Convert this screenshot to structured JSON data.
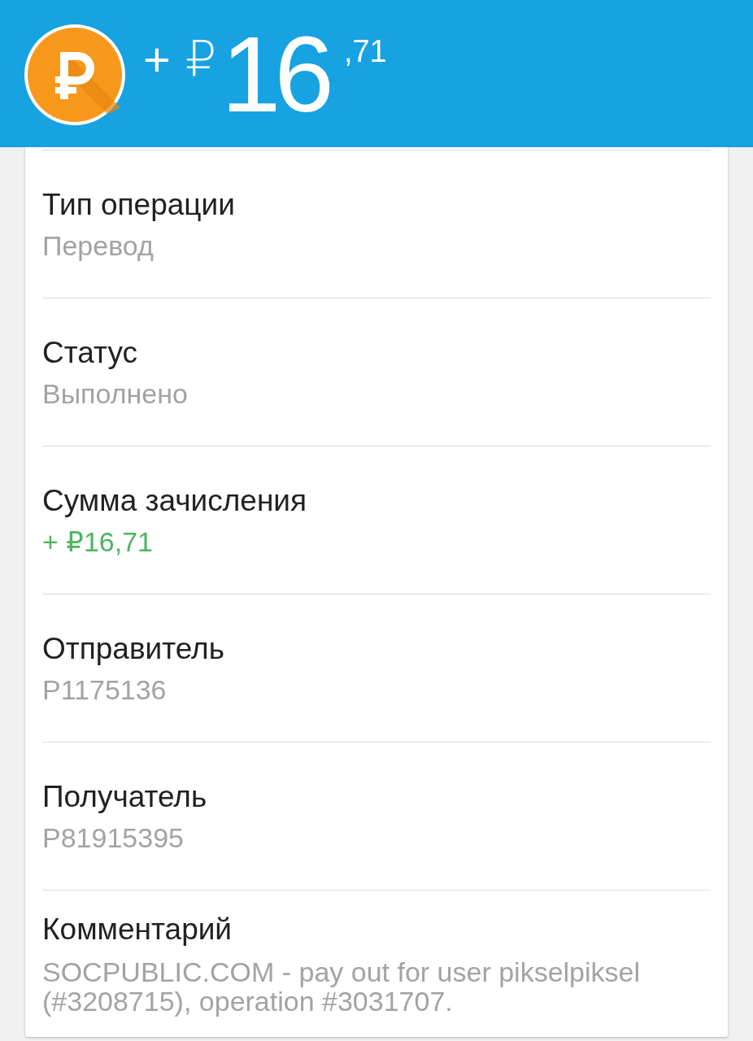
{
  "header": {
    "amount": {
      "sign": "+",
      "currency": "₽",
      "whole": "16",
      "fraction": ",71"
    }
  },
  "details": [
    {
      "label": "Тип операции",
      "value": "Перевод",
      "kind": "text"
    },
    {
      "label": "Статус",
      "value": "Выполнено",
      "kind": "text"
    },
    {
      "label": "Сумма зачисления",
      "value": "+ ₽16,71",
      "kind": "credit"
    },
    {
      "label": "Отправитель",
      "value": "P1175136",
      "kind": "text"
    },
    {
      "label": "Получатель",
      "value": "P81915395",
      "kind": "text"
    },
    {
      "label": "Комментарий",
      "value": "SOCPUBLIC.COM - pay out for user pikselpiksel (#3208715), operation #3031707.",
      "kind": "text"
    }
  ]
}
